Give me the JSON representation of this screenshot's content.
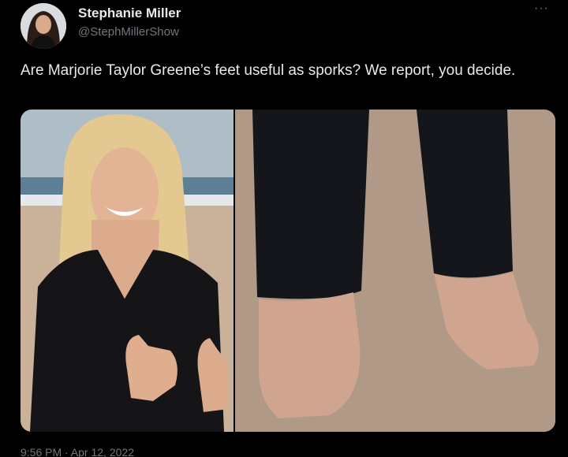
{
  "author": {
    "display_name": "Stephanie Miller",
    "handle": "@StephMillerShow"
  },
  "tweet": {
    "text": "Are Marjorie Taylor Greene’s feet useful as sporks?  We report, you decide.",
    "timestamp": "9:56 PM · Apr 12, 2022"
  },
  "menu": {
    "more_label": "···"
  },
  "colors": {
    "background": "#000000",
    "text_primary": "#e7e9ea",
    "text_secondary": "#71767b"
  }
}
